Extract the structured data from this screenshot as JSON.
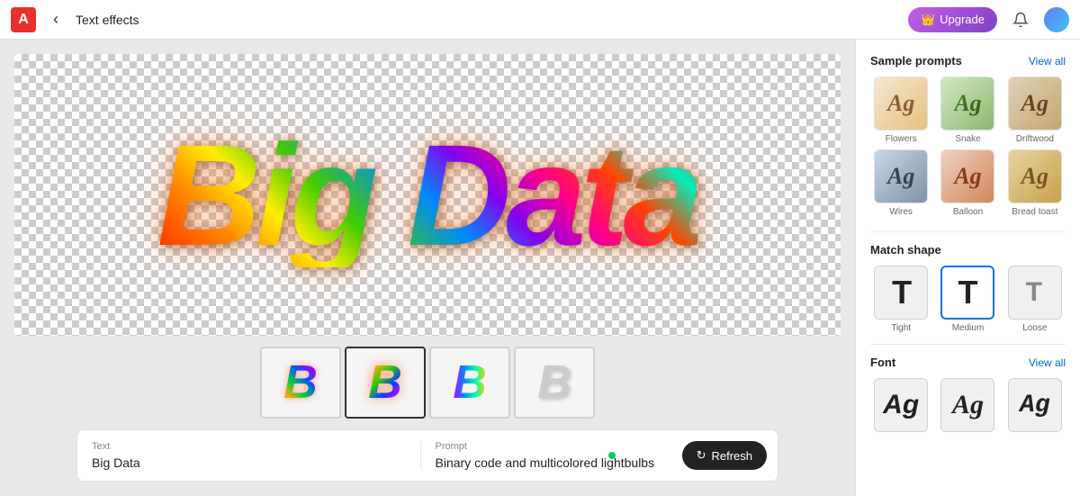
{
  "topbar": {
    "app_logo": "A",
    "back_icon": "‹",
    "title": "Text effects",
    "upgrade_label": "Upgrade",
    "bell_icon": "🔔",
    "avatar_initials": ""
  },
  "canvas": {
    "main_text": "Big Data"
  },
  "thumbnails": [
    {
      "letter": "B",
      "style": "colorful-matrix",
      "selected": false
    },
    {
      "letter": "B",
      "style": "colorful-matrix-2",
      "selected": true
    },
    {
      "letter": "B",
      "style": "colorful-blue",
      "selected": false
    },
    {
      "letter": "B",
      "style": "outline",
      "selected": false
    }
  ],
  "input_panel": {
    "text_label": "Text",
    "text_value": "Big Data",
    "prompt_label": "Prompt",
    "prompt_value": "Binary code and multicolored lightbulbs",
    "refresh_label": "Refresh"
  },
  "sidebar": {
    "sample_prompts_title": "Sample prompts",
    "view_all_label": "View all",
    "samples": [
      {
        "label": "Flowers"
      },
      {
        "label": "Snake"
      },
      {
        "label": "Driftwood"
      },
      {
        "label": "Wires"
      },
      {
        "label": "Balloon"
      },
      {
        "label": "Bread toast"
      }
    ],
    "match_shape_title": "Match shape",
    "shapes": [
      {
        "label": "Tight",
        "selected": false
      },
      {
        "label": "Medium",
        "selected": true
      },
      {
        "label": "Loose",
        "selected": false
      }
    ],
    "font_title": "Font",
    "font_view_all": "View all"
  }
}
